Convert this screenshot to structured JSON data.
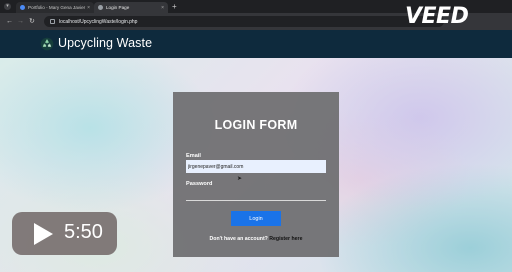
{
  "browser": {
    "menu_icon": "chevron-down-icon",
    "tabs": [
      {
        "label": "Portfolio - Mary Gena Javier",
        "active": false,
        "favicon_color": "#4c8bf5"
      },
      {
        "label": "Login Page",
        "active": true,
        "favicon_color": "#9aa0a6"
      }
    ],
    "tab_close": "×",
    "new_tab": "+",
    "url": "localhost/UpcyclingWaste/login.php"
  },
  "site": {
    "title": "Upcycling Waste",
    "logo_icon": "recycle-icon"
  },
  "login": {
    "heading": "LOGIN FORM",
    "email_label": "Email",
    "email_value": "jirgenepaver@gmail.com",
    "password_label": "Password",
    "password_value": "",
    "button_label": "Login",
    "signup_prompt": "Don't have an account?",
    "register_link": "Register here"
  },
  "overlay": {
    "brand": "VEED",
    "duration": "5:50",
    "play_icon": "play-icon"
  },
  "colors": {
    "header_bg": "#0e2a3d",
    "card_bg": "#6e6e70",
    "button_bg": "#1a73e8",
    "input_bg": "#e8f0fe"
  }
}
